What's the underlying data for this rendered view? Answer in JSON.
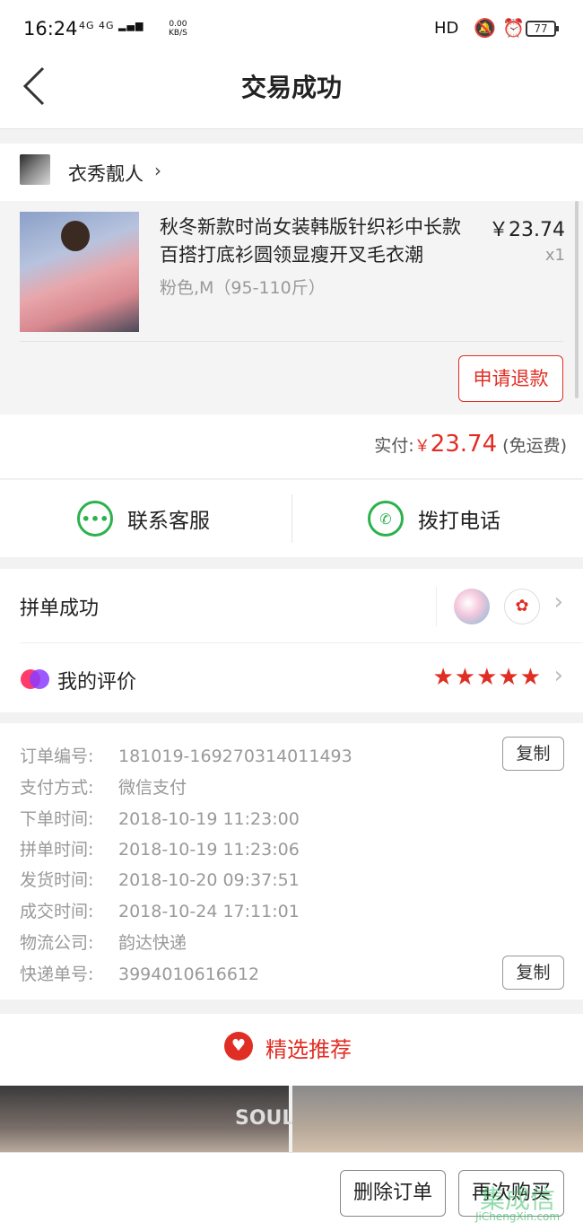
{
  "status_bar": {
    "time": "16:24",
    "network": "4G 4G",
    "speed_value": "0.00",
    "speed_unit": "KB/S",
    "hd": "HD",
    "battery": "77"
  },
  "header": {
    "title": "交易成功"
  },
  "shop": {
    "name": "衣秀靓人"
  },
  "product": {
    "title": "秋冬新款时尚女装韩版针织衫中长款百搭打底衫圆领显瘦开叉毛衣潮",
    "price": "￥23.74",
    "quantity": "x1",
    "spec": "粉色,M（95-110斤）",
    "refund_label": "申请退款"
  },
  "payment": {
    "paid_label": "实付:",
    "currency": "￥",
    "amount": "23.74",
    "shipping_note": "(免运费)"
  },
  "contact": {
    "service_label": "联系客服",
    "phone_label": "拨打电话"
  },
  "group": {
    "label": "拼单成功"
  },
  "review": {
    "label": "我的评价",
    "rating": 5
  },
  "order_info": {
    "rows": [
      {
        "key": "订单编号:",
        "value": "181019-169270314011493"
      },
      {
        "key": "支付方式:",
        "value": "微信支付"
      },
      {
        "key": "下单时间:",
        "value": "2018-10-19 11:23:00"
      },
      {
        "key": "拼单时间:",
        "value": "2018-10-19 11:23:06"
      },
      {
        "key": "发货时间:",
        "value": "2018-10-20 09:37:51"
      },
      {
        "key": "成交时间:",
        "value": "2018-10-24 17:11:01"
      },
      {
        "key": "物流公司:",
        "value": "韵达快递"
      },
      {
        "key": "快递单号:",
        "value": "3994010616612"
      }
    ],
    "copy_label": "复制"
  },
  "recommend": {
    "title": "精选推荐",
    "image_text": "SOUL"
  },
  "bottom_bar": {
    "delete_label": "删除订单",
    "rebuy_label": "再次购买",
    "watermark": "集成信",
    "watermark_url": "JiChengXin.com"
  },
  "colors": {
    "accent": "#e02e24",
    "wechat_green": "#2bb24c"
  }
}
